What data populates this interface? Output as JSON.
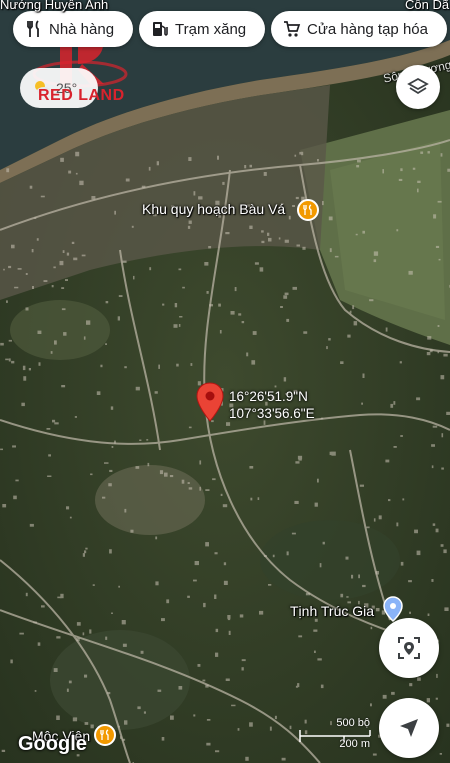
{
  "map": {
    "type": "satellite",
    "top_edge_labels": [
      "Nướng Huyền Anh",
      "Cồn Dã"
    ],
    "river_label": "Sông Hương"
  },
  "chips": [
    {
      "label": "Nhà hàng",
      "icon": "restaurant-icon"
    },
    {
      "label": "Trạm xăng",
      "icon": "gas-station-icon"
    },
    {
      "label": "Cửa hàng tạp hóa",
      "icon": "shopping-cart-icon"
    }
  ],
  "watermark": {
    "text": "RED LAND",
    "color": "#d9232d"
  },
  "weather": {
    "temperature": "25°"
  },
  "pois": [
    {
      "name": "Khu quy hoạch Bàu Vá",
      "icon": "restaurant-icon",
      "color": "#f29900"
    },
    {
      "name": "Tịnh Trúc Gia",
      "icon": "place-icon",
      "color": "#8ab4f8"
    },
    {
      "name": "Mộc Viên",
      "icon": "restaurant-icon",
      "color": "#f29900"
    }
  ],
  "dropped_pin": {
    "latitude": "16°26'51.9\"N",
    "longitude": "107°33'56.6\"E",
    "color": "#ea4335"
  },
  "scale_bar": {
    "top": "500 bộ",
    "bottom": "200 m"
  },
  "attribution": "Google"
}
